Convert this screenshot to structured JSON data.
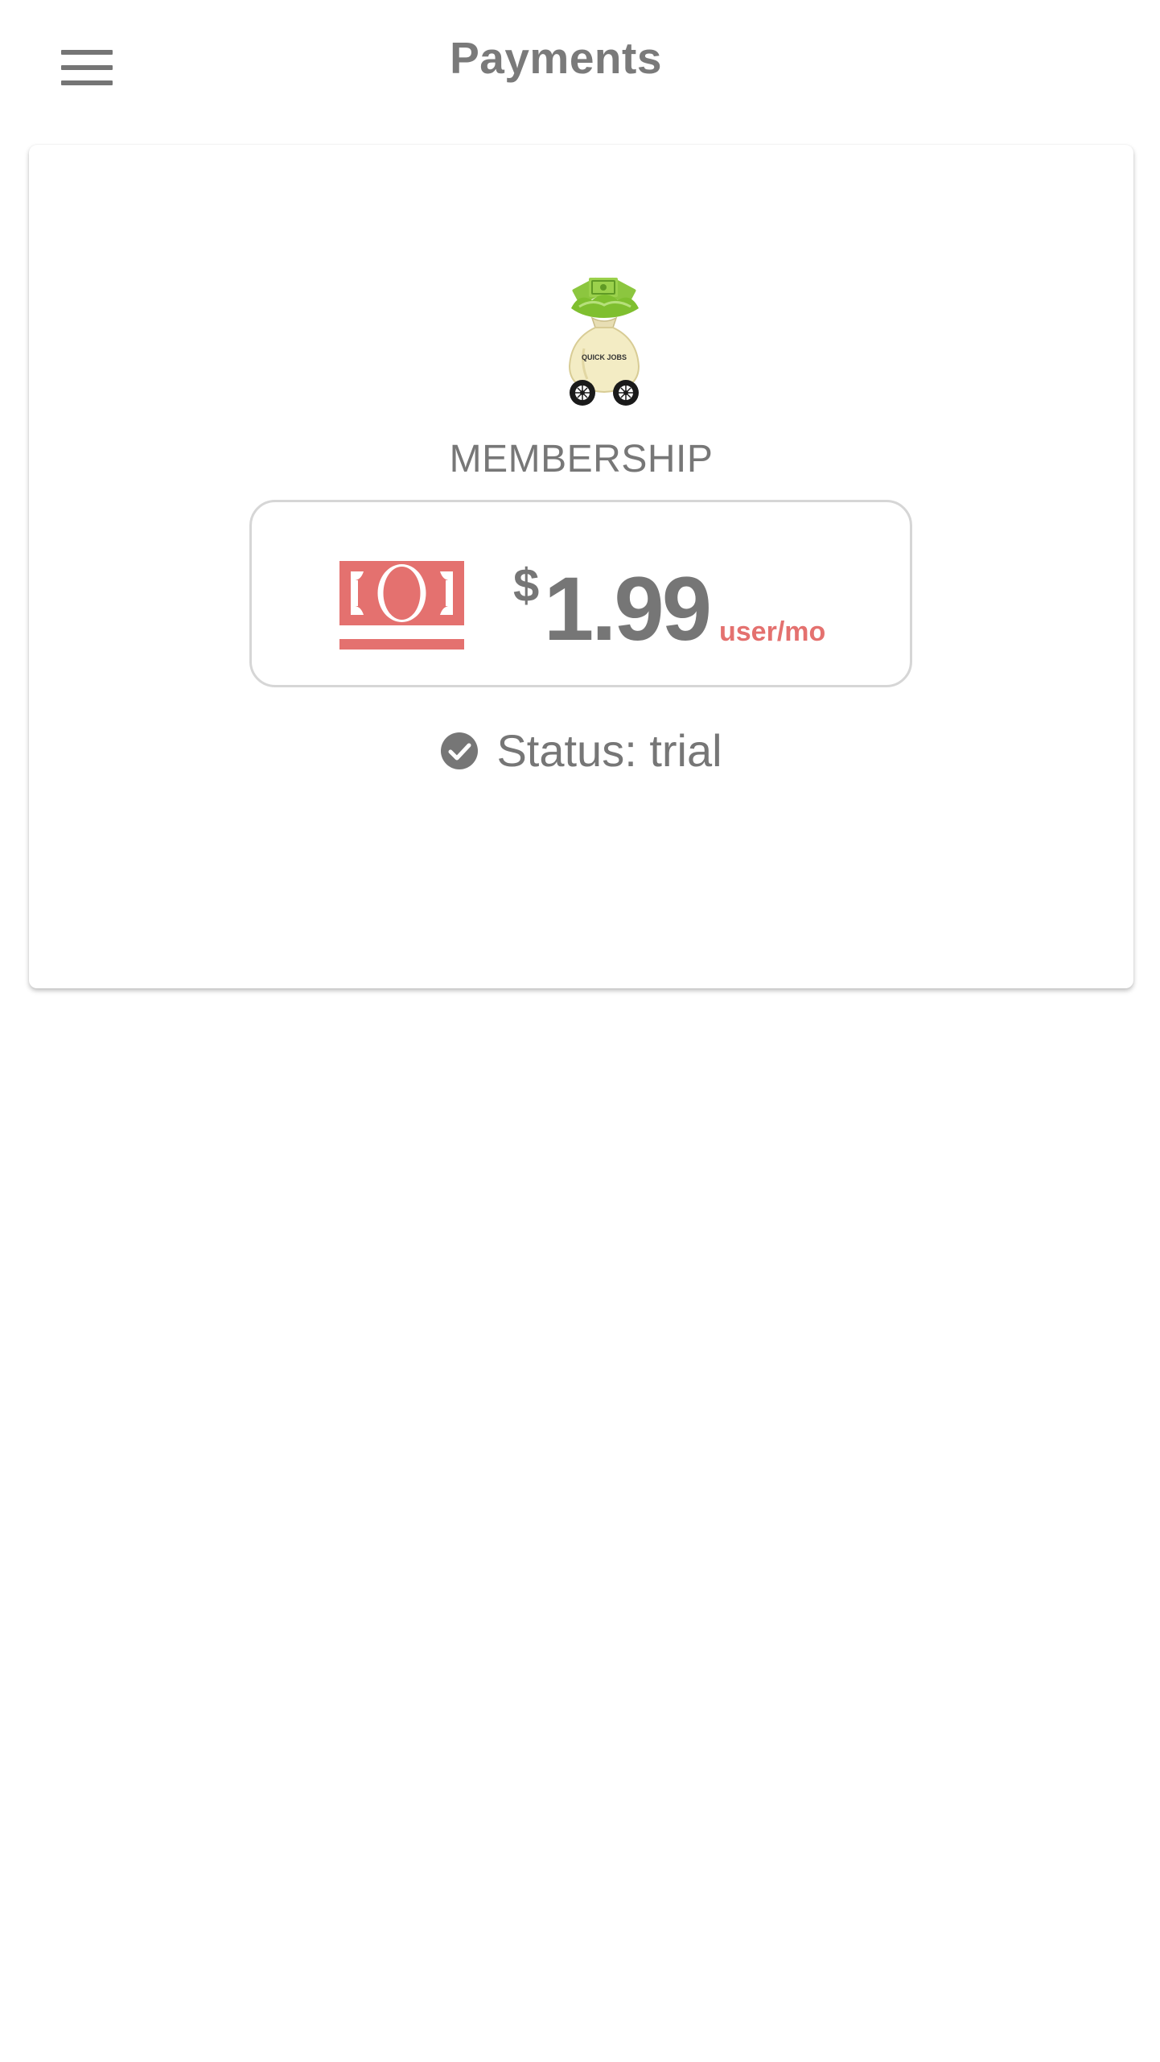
{
  "header": {
    "menu_icon": "hamburger-menu-icon",
    "title": "Payments"
  },
  "membership": {
    "logo_icon": "quick-jobs-money-bag-logo",
    "logo_text": "QUICK JOBS",
    "plan_label": "MEMBERSHIP",
    "price": {
      "icon": "money-bill-icon",
      "currency": "$",
      "amount": "1.99",
      "unit": "user/mo"
    },
    "status": {
      "icon": "check-circle-icon",
      "text": "Status: trial"
    }
  },
  "colors": {
    "text_gray": "#767676",
    "accent_red": "#e4716f",
    "border": "#d6d6d6",
    "background": "#ffffff"
  }
}
